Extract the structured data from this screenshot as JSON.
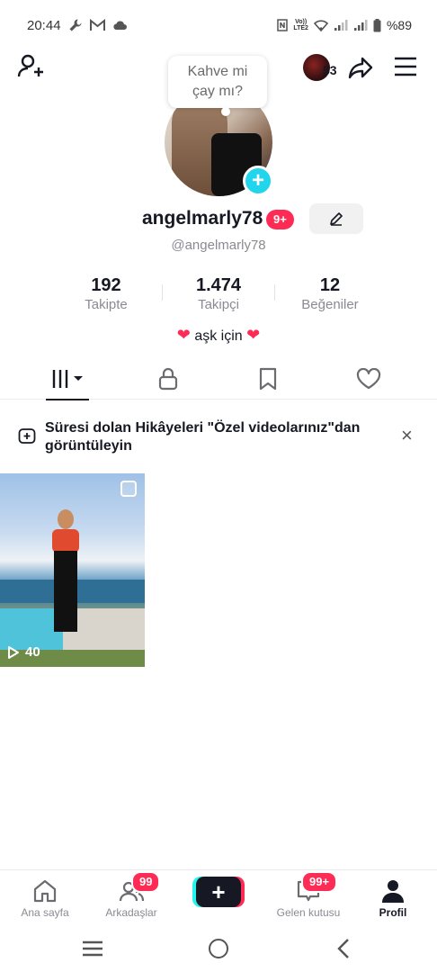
{
  "status_bar": {
    "time": "20:44",
    "lte_top": "Vo))",
    "lte_bottom": "LTE2",
    "battery": "%89"
  },
  "header": {
    "notification_count": "53"
  },
  "bubble": {
    "text_line1": "Kahve mi",
    "text_line2": "çay mı?"
  },
  "profile": {
    "username": "angelmarly78",
    "username_badge": "9+",
    "handle": "@angelmarly78",
    "bio_text": "aşk için"
  },
  "stats": [
    {
      "value": "192",
      "label": "Takipte"
    },
    {
      "value": "1.474",
      "label": "Takipçi"
    },
    {
      "value": "12",
      "label": "Beğeniler"
    }
  ],
  "notice": {
    "text": "Süresi dolan Hikâyeleri \"Özel videolarınız\"dan görüntüleyin",
    "close": "×"
  },
  "videos": [
    {
      "views": "40"
    }
  ],
  "bottom_nav": {
    "home": "Ana sayfa",
    "friends": "Arkadaşlar",
    "friends_badge": "99",
    "create": "+",
    "inbox": "Gelen kutusu",
    "inbox_badge": "99+",
    "profile": "Profil"
  },
  "colors": {
    "accent": "#fe2c55",
    "teal": "#20d5ec",
    "text": "#161823",
    "muted": "#8a8b91"
  }
}
